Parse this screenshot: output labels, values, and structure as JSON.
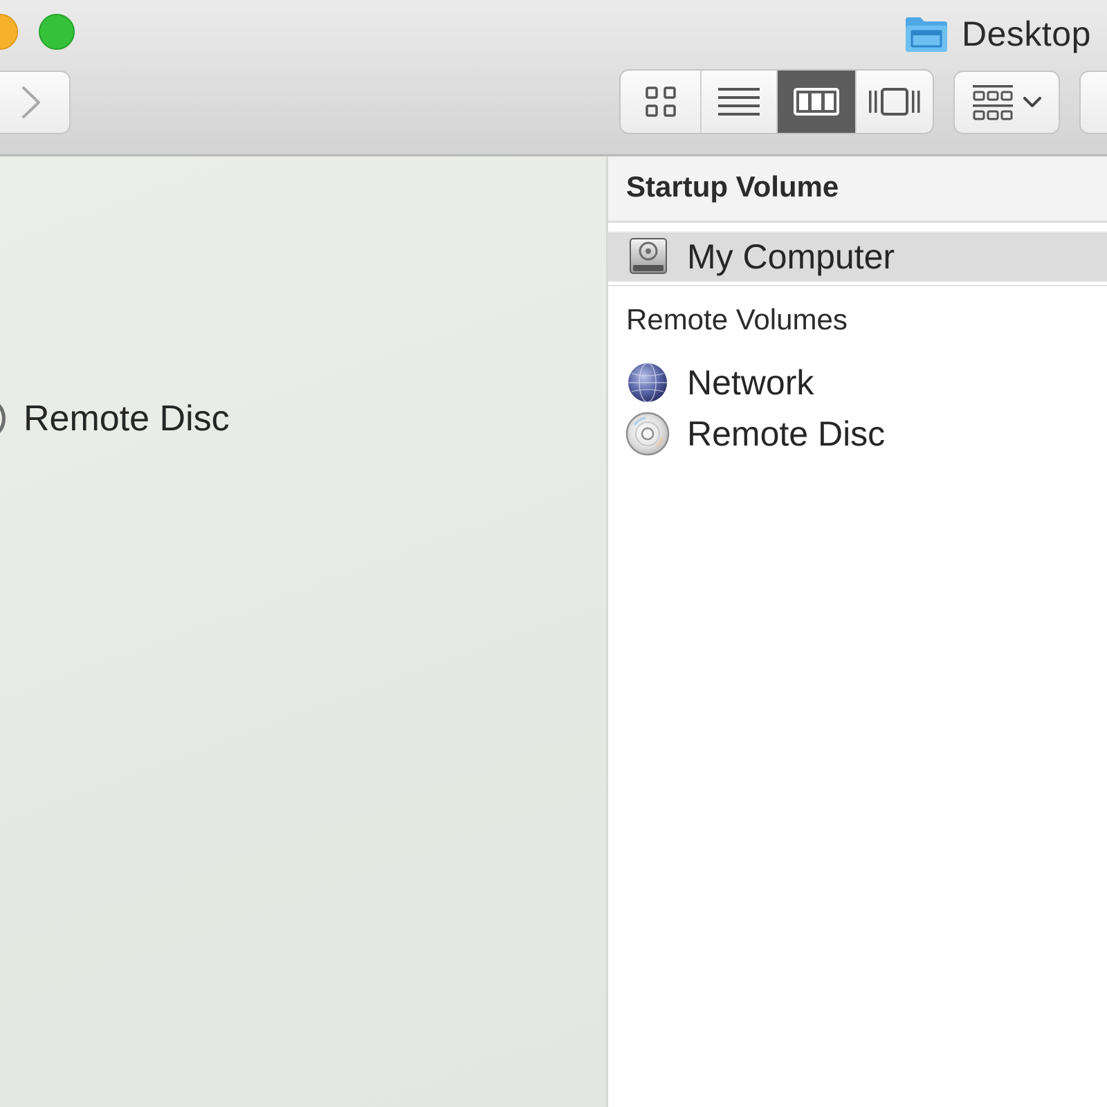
{
  "window": {
    "title": "Desktop",
    "title_icon": "folder-icon"
  },
  "toolbar": {
    "traffic_lights": [
      {
        "name": "minimize",
        "color": "#f5b22a"
      },
      {
        "name": "zoom",
        "color": "#35c13b"
      }
    ],
    "forward_icon": "chevron-right-icon",
    "view_modes": [
      {
        "name": "icon-view",
        "icon": "grid-icon",
        "selected": false
      },
      {
        "name": "list-view",
        "icon": "list-icon",
        "selected": false
      },
      {
        "name": "column-view",
        "icon": "columns-icon",
        "selected": true
      },
      {
        "name": "cover-flow-view",
        "icon": "cover-flow-icon",
        "selected": false
      }
    ],
    "arrange_icon": "arrange-grid-icon"
  },
  "left_column": {
    "items": [
      {
        "label": "Remote Disc",
        "icon": "disc-icon"
      }
    ]
  },
  "right_column": {
    "sections": [
      {
        "title": "Startup Volume",
        "items": [
          {
            "label": "My Computer",
            "icon": "hard-drive-icon",
            "selected": true
          }
        ]
      },
      {
        "title": "Remote Volumes",
        "items": [
          {
            "label": "Network",
            "icon": "globe-icon",
            "selected": false
          },
          {
            "label": "Remote Disc",
            "icon": "disc-icon",
            "selected": false
          }
        ]
      }
    ]
  },
  "colors": {
    "selected_row": "#dcdcdc",
    "active_segment": "#5d5d5d",
    "folder_blue": "#4ea8e6"
  }
}
